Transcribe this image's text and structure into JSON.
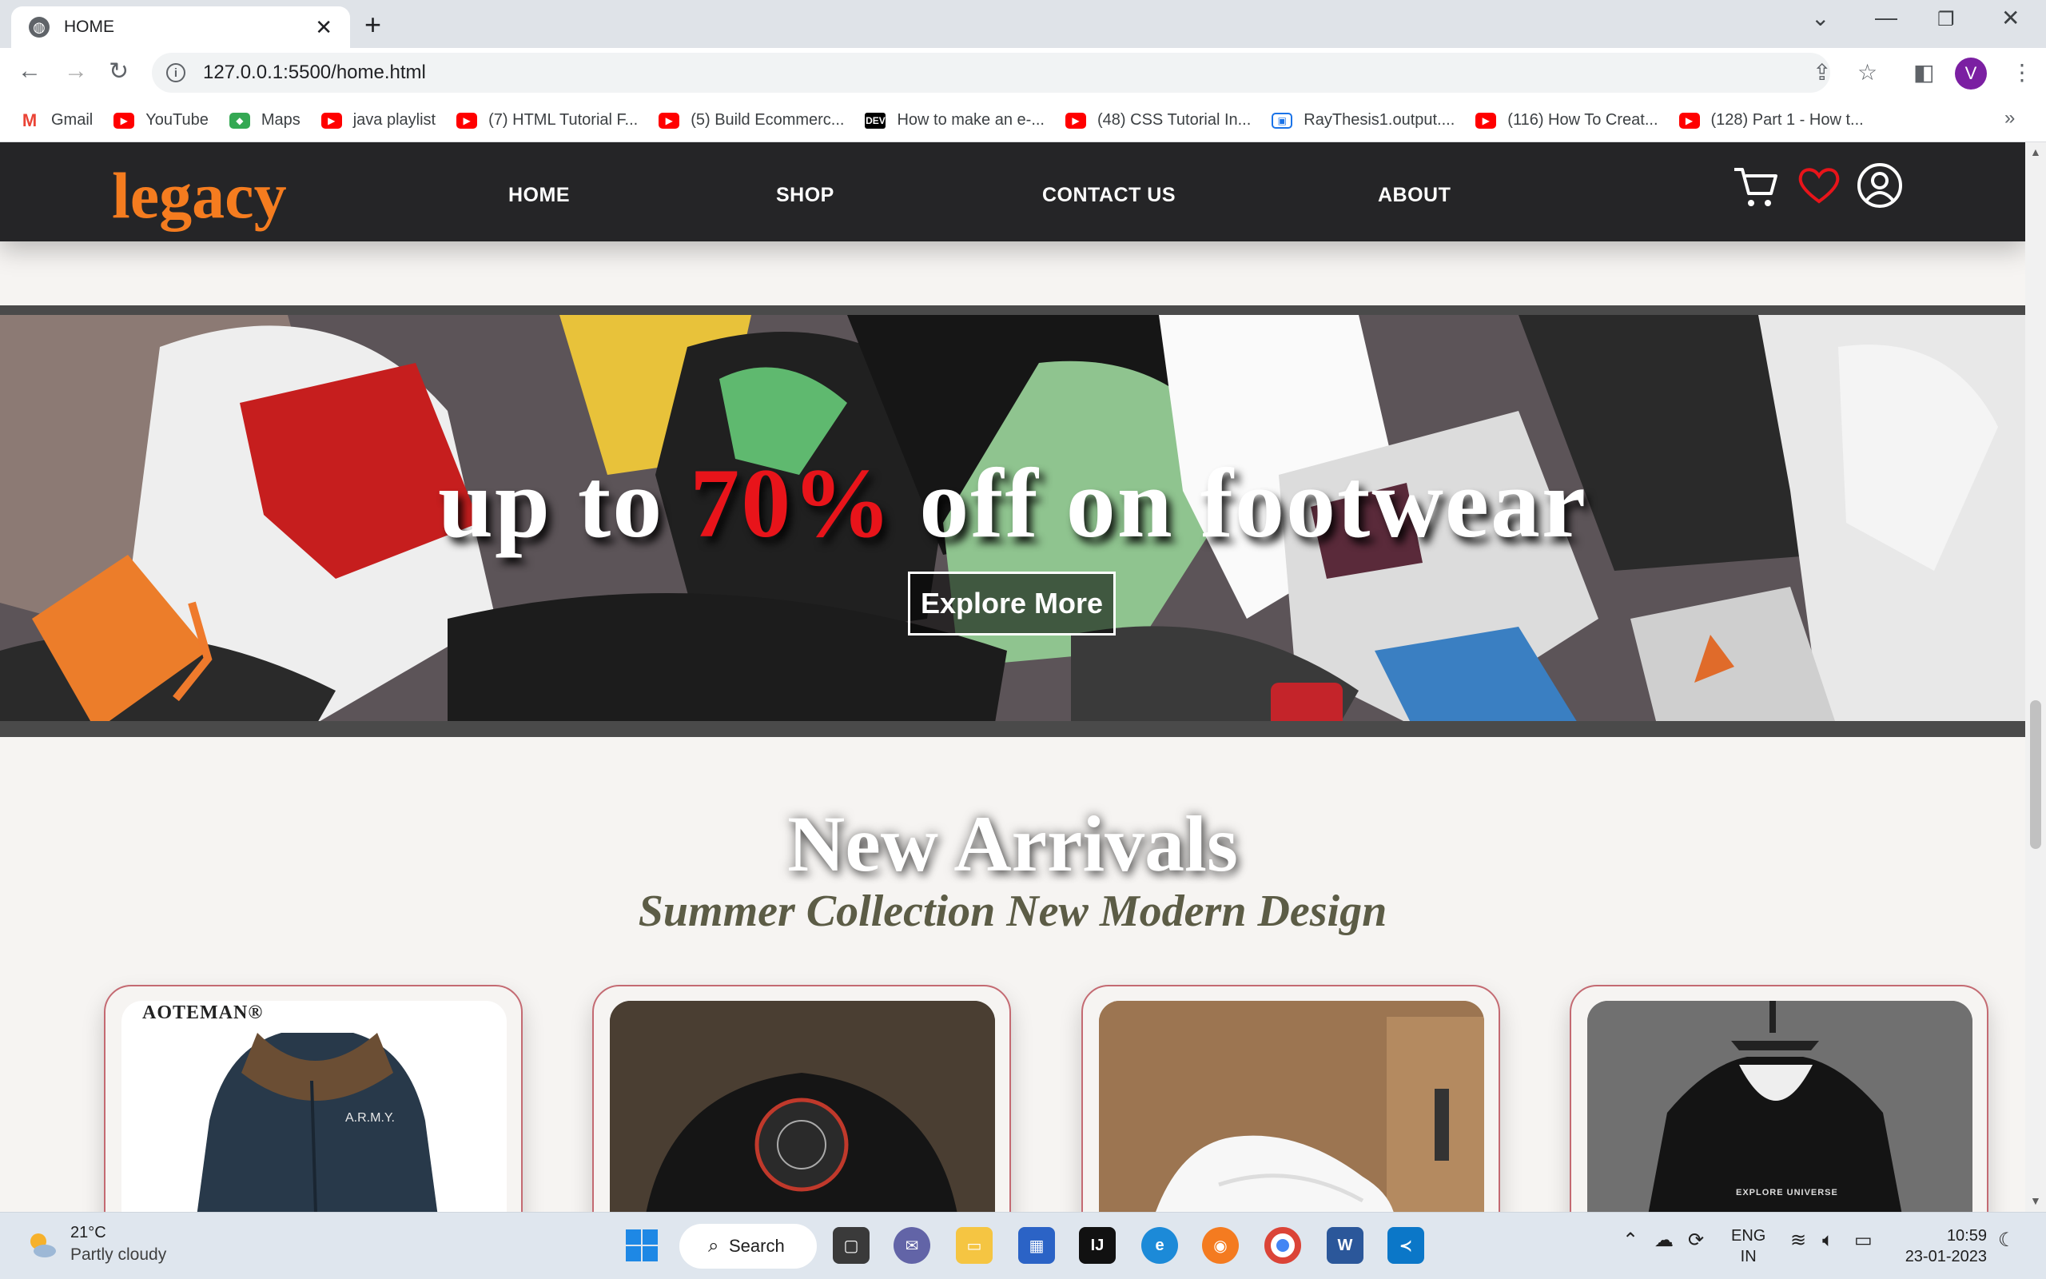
{
  "browser": {
    "tab_title": "HOME",
    "new_tab": "+",
    "url": "127.0.0.1:5500/home.html",
    "profile_initial": "V",
    "bookmarks": [
      {
        "label": "Gmail",
        "icon": "gmail"
      },
      {
        "label": "YouTube",
        "icon": "youtube"
      },
      {
        "label": "Maps",
        "icon": "maps"
      },
      {
        "label": "java playlist",
        "icon": "youtube"
      },
      {
        "label": "(7) HTML Tutorial F...",
        "icon": "youtube"
      },
      {
        "label": "(5) Build Ecommerc...",
        "icon": "youtube"
      },
      {
        "label": "How to make an e-...",
        "icon": "dev"
      },
      {
        "label": "(48) CSS Tutorial In...",
        "icon": "youtube"
      },
      {
        "label": "RayThesis1.output....",
        "icon": "raythesis"
      },
      {
        "label": "(116) How To Creat...",
        "icon": "youtube"
      },
      {
        "label": "(128) Part 1 - How t...",
        "icon": "youtube"
      }
    ],
    "bookmarks_more": "»"
  },
  "site": {
    "logo": "legacy",
    "nav": [
      "HOME",
      "SHOP",
      "CONTACT US",
      "ABOUT"
    ],
    "hero": {
      "title_before": "up to ",
      "title_highlight": "70%",
      "title_after": " off on footwear",
      "button": "Explore More"
    },
    "arrivals": {
      "title": "New Arrivals",
      "subtitle": "Summer Collection New Modern Design"
    },
    "products": [
      {
        "brand": "AOTEMAN®",
        "tag": "A.R.M.Y."
      },
      {
        "brand": ""
      },
      {
        "brand": ""
      },
      {
        "brand": "",
        "tag": "EXPLORE UNIVERSE"
      }
    ],
    "colors": {
      "accent": "#f57c1f",
      "header": "#252527",
      "highlight": "#e8141a"
    }
  },
  "taskbar": {
    "temperature": "21°C",
    "condition": "Partly cloudy",
    "search": "Search",
    "lang_top": "ENG",
    "lang_bottom": "IN",
    "time": "10:59",
    "date": "23-01-2023"
  }
}
